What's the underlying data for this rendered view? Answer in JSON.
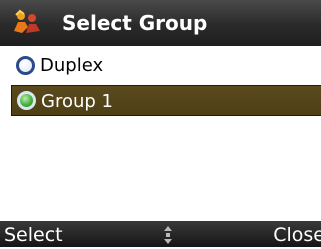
{
  "title": {
    "text": "Select Group",
    "icon": "group-people-icon"
  },
  "list": {
    "items": [
      {
        "label": "Duplex",
        "selected": false
      },
      {
        "label": "Group 1",
        "selected": true
      }
    ]
  },
  "softkeys": {
    "left_label": "Select",
    "right_label": "Close",
    "center_icon": "scroll-updown-icon"
  },
  "colors": {
    "titlebar": "#2a2a2a",
    "highlight": "#54441a",
    "radio_on": "#48b040",
    "radio_off_border": "#2c4a8a"
  }
}
